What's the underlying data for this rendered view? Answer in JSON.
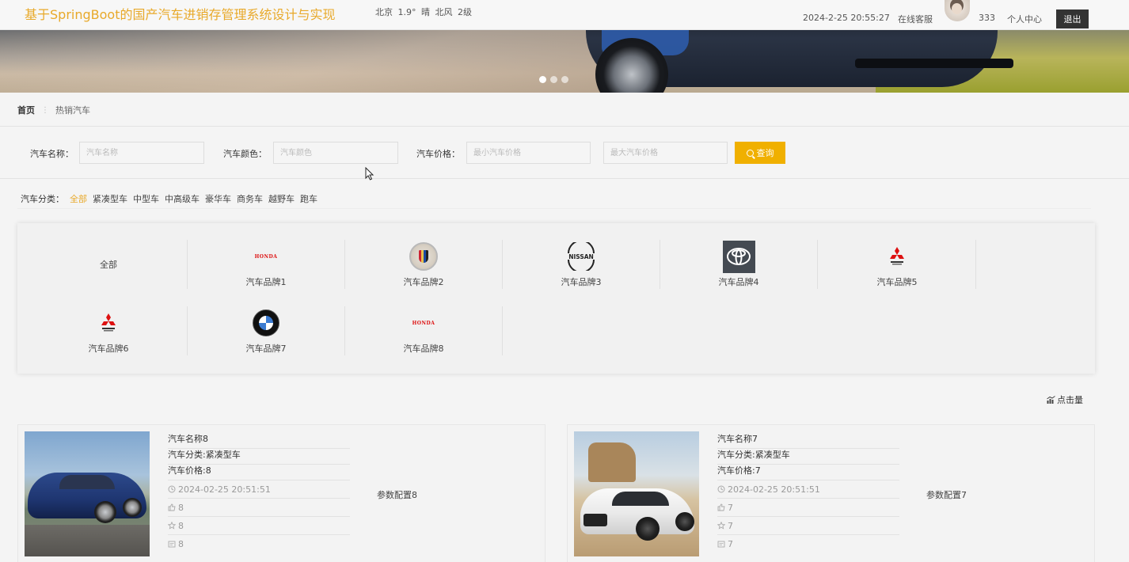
{
  "header": {
    "title": "基于SpringBoot的国产汽车进销存管理系统设计与实现",
    "weather": "北京 1.9° 晴 北风 2级",
    "datetime": "2024-2-25 20:55:27",
    "online_service": "在线客服",
    "username": "333",
    "personal_center": "个人中心",
    "logout": "退出"
  },
  "banner": {
    "dots": 3,
    "active_dot": 1
  },
  "breadcrumb": {
    "home": "首页",
    "current": "热销汽车"
  },
  "search": {
    "name_label": "汽车名称：",
    "name_placeholder": "汽车名称",
    "color_label": "汽车颜色：",
    "color_placeholder": "汽车颜色",
    "price_label": "汽车价格：",
    "min_price_placeholder": "最小汽车价格",
    "max_price_placeholder": "最大汽车价格",
    "query_label": "查询"
  },
  "category": {
    "label": "汽车分类：",
    "items": [
      "全部",
      "紧凑型车",
      "中型车",
      "中高级车",
      "豪华车",
      "商务车",
      "越野车",
      "跑车"
    ],
    "active": "全部"
  },
  "brands": {
    "all": "全部",
    "items": [
      {
        "name": "汽车品牌1",
        "logo": "honda-logo",
        "logo_text": "HONDA"
      },
      {
        "name": "汽车品牌2",
        "logo": "cadillac-logo"
      },
      {
        "name": "汽车品牌3",
        "logo": "nissan-logo",
        "logo_text": "NISSAN"
      },
      {
        "name": "汽车品牌4",
        "logo": "toyota-logo"
      },
      {
        "name": "汽车品牌5",
        "logo": "mitsubishi-logo"
      },
      {
        "name": "汽车品牌6",
        "logo": "mitsubishi-logo"
      },
      {
        "name": "汽车品牌7",
        "logo": "bmw-logo"
      },
      {
        "name": "汽车品牌8",
        "logo": "honda-logo",
        "logo_text": "HONDA"
      }
    ]
  },
  "sort": {
    "label": "点击量"
  },
  "products": [
    {
      "name": "汽车名称8",
      "category": "汽车分类:紧凑型车",
      "price": "汽车价格:8",
      "time": "2024-02-25 20:51:51",
      "likes": "8",
      "favorites": "8",
      "comments": "8",
      "config": "参数配置8"
    },
    {
      "name": "汽车名称7",
      "category": "汽车分类:紧凑型车",
      "price": "汽车价格:7",
      "time": "2024-02-25 20:51:51",
      "likes": "7",
      "favorites": "7",
      "comments": "7",
      "config": "参数配置7"
    }
  ],
  "colors": {
    "accent": "#e8a92a",
    "query_button": "#f0b000",
    "logout_button": "#333333"
  }
}
